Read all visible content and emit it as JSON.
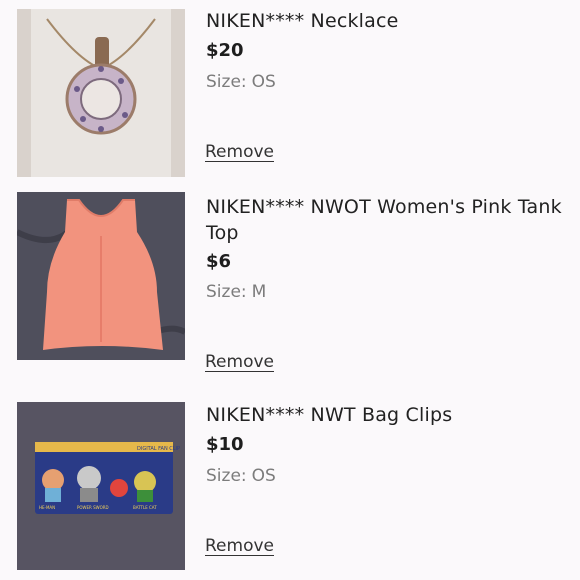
{
  "items": [
    {
      "title": "NIKEN**** Necklace",
      "price": "$20",
      "size_label": "Size:",
      "size_value": "OS",
      "remove_label": "Remove",
      "image_icon": "necklace-photo"
    },
    {
      "title": "NIKEN**** NWOT Women's Pink Tank Top",
      "price": "$6",
      "size_label": "Size:",
      "size_value": "M",
      "remove_label": "Remove",
      "image_icon": "tank-top-photo"
    },
    {
      "title": "NIKEN**** NWT Bag Clips",
      "price": "$10",
      "size_label": "Size:",
      "size_value": "OS",
      "remove_label": "Remove",
      "image_icon": "bag-clips-photo",
      "image_text": [
        "DIGITAL FAN CLIP",
        "HE-MAN",
        "POWER SWORD",
        "BATTLE CAT"
      ]
    }
  ],
  "colors": {
    "background": "#fbf9fb",
    "price": "#1e1e1e",
    "size": "#7c7c7c"
  }
}
